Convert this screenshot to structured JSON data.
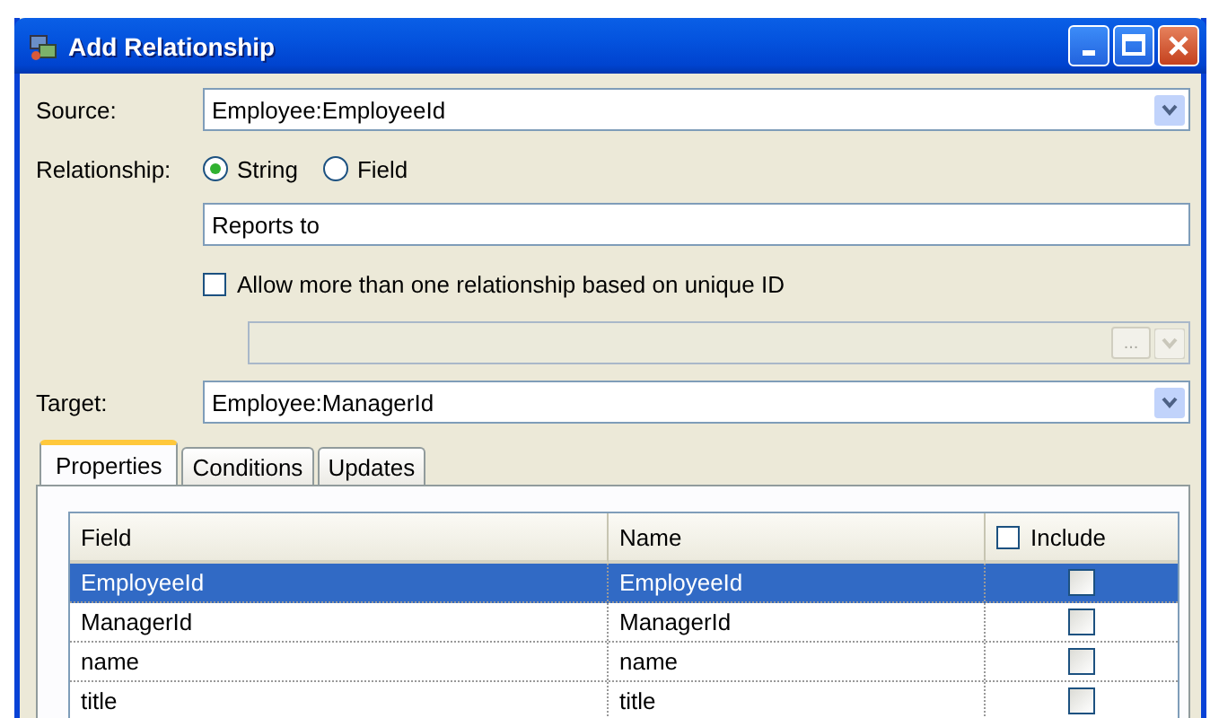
{
  "window": {
    "title": "Add Relationship"
  },
  "source": {
    "label": "Source:",
    "value": "Employee:EmployeeId"
  },
  "relationship": {
    "label": "Relationship:",
    "options": [
      {
        "label": "String",
        "selected": true
      },
      {
        "label": "Field",
        "selected": false
      }
    ],
    "value": "Reports to"
  },
  "allow_multiple": {
    "label": "Allow more than one relationship based on unique ID",
    "checked": false,
    "browse_label": "..."
  },
  "target": {
    "label": "Target:",
    "value": "Employee:ManagerId"
  },
  "tabs": [
    {
      "label": "Properties",
      "selected": true
    },
    {
      "label": "Conditions",
      "selected": false
    },
    {
      "label": "Updates",
      "selected": false
    }
  ],
  "table": {
    "columns": [
      "Field",
      "Name",
      "Include"
    ],
    "include_all": false,
    "rows": [
      {
        "field": "EmployeeId",
        "name": "EmployeeId",
        "include": false,
        "selected": true
      },
      {
        "field": "ManagerId",
        "name": "ManagerId",
        "include": false,
        "selected": false
      },
      {
        "field": "name",
        "name": "name",
        "include": false,
        "selected": false
      },
      {
        "field": "title",
        "name": "title",
        "include": false,
        "selected": false
      }
    ]
  }
}
